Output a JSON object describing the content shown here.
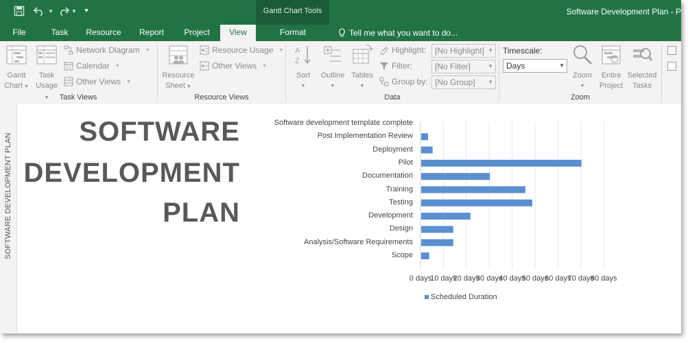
{
  "window": {
    "title": "Software Development Plan - P",
    "context_group": "Gantt Chart Tools"
  },
  "tabs": [
    "File",
    "Task",
    "Resource",
    "Report",
    "Project",
    "View",
    "Format"
  ],
  "active_tab": "View",
  "tell_me": "Tell me what you want to do...",
  "ribbon": {
    "task_views": {
      "label": "Task Views",
      "gantt_chart": [
        "Gantt",
        "Chart"
      ],
      "task_usage": [
        "Task",
        "Usage"
      ],
      "network_diagram": "Network Diagram",
      "calendar": "Calendar",
      "other_views": "Other Views"
    },
    "resource_views": {
      "label": "Resource Views",
      "resource_sheet": [
        "Resource",
        "Sheet"
      ],
      "resource_usage": "Resource Usage",
      "other_views": "Other Views"
    },
    "data": {
      "label": "Data",
      "sort": "Sort",
      "outline": "Outline",
      "tables": "Tables",
      "highlight": "Highlight:",
      "highlight_value": "[No Highlight]",
      "filter": "Filter:",
      "filter_value": "[No Filter]",
      "group_by": "Group by:",
      "group_value": "[No Group]"
    },
    "zoom": {
      "label": "Zoom",
      "timescale": "Timescale:",
      "timescale_value": "Days",
      "zoom": "Zoom",
      "entire_project": [
        "Entire",
        "Project"
      ],
      "selected_tasks": [
        "Selected",
        "Tasks"
      ]
    }
  },
  "sidebar_label": "SOFTWARE DEVELOPMENT PLAN",
  "report_title": [
    "SOFTWARE",
    "DEVELOPMENT",
    "PLAN"
  ],
  "chart_data": {
    "type": "bar",
    "orientation": "horizontal",
    "categories": [
      "Software development template complete",
      "Post Implementation Review",
      "Deployment",
      "Pilot",
      "Documentation",
      "Training",
      "Testing",
      "Development",
      "Design",
      "Analysis/Software Requirements",
      "Scope"
    ],
    "series": [
      {
        "name": "Scheduled Duration",
        "values": [
          0,
          3,
          5,
          70,
          30,
          45.5,
          48.5,
          21.5,
          14,
          14,
          3.5
        ],
        "color": "#5b8fcf"
      }
    ],
    "xticks": [
      "0 days",
      "10 days",
      "20 days",
      "30 days",
      "40 days",
      "50 days",
      "60 days",
      "70 days",
      "80 days"
    ],
    "xlim": [
      0,
      80
    ],
    "grid": true,
    "legend_position": "bottom-left"
  }
}
